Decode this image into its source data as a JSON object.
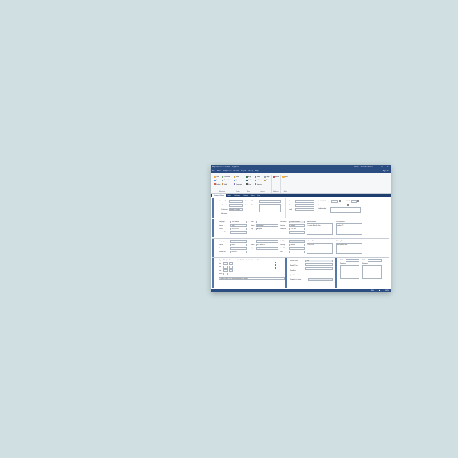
{
  "window": {
    "title": "Ship Shipments 2 (2/02) - ShipTrack",
    "user": "Admin",
    "status": "No Label Printer",
    "controls": {
      "minimize": "—",
      "maximize": "☐",
      "close": "✕"
    }
  },
  "menu": {
    "items": [
      "File",
      "Home",
      "Shipments",
      "Search",
      "Reports",
      "Setup",
      "Help"
    ],
    "right": "Sign Out"
  },
  "ribbon": {
    "groups": [
      {
        "label": "Shipment",
        "buttons": [
          "New",
          "Save",
          "Delete",
          "Duplicate",
          "Cancel",
          "Void"
        ]
      },
      {
        "label": "Rates",
        "buttons": [
          "Rate",
          "Quote",
          "Compare"
        ]
      },
      {
        "label": "Ship",
        "buttons": [
          "Ship",
          "Hold",
          "Print"
        ]
      },
      {
        "label": "Products",
        "buttons": [
          "Add",
          "Edit",
          "Remove",
          "Copy",
          "Paste"
        ]
      },
      {
        "label": "Address",
        "buttons": [
          "Book"
        ]
      },
      {
        "label": "Help",
        "buttons": [
          "Help"
        ]
      }
    ]
  },
  "tabs": [
    "Shipment Details",
    "Rates",
    "Packages",
    "History",
    "Notes",
    "Log"
  ],
  "sections": {
    "s1": {
      "left": {
        "shipment_label": "Shipment ID",
        "shipment_value": "SHP-000548",
        "account_label": "Account",
        "account_value": "Account 01",
        "customer_label": "Customer",
        "customer_value": "Sample Customer",
        "reference_label": "Reference",
        "reference_value": "",
        "phone_label": "Customer Phone",
        "phone_value": "555-555-5555",
        "notes_label": "Customer Notes"
      },
      "right": {
        "name_label": "Name",
        "phone_label": "Phone",
        "email_label": "Email",
        "cod_label": "Cash On Delivery",
        "cod_value": "0.00",
        "cod_fee_label": "COD Fee",
        "cod_fee_value": "0.00",
        "insurance_label": "Insurance",
        "undeliverable_label": "Undeliverable"
      }
    },
    "s2": {
      "company_label": "Company",
      "company_value": "Test Company",
      "contact_label": "Contact",
      "contact_value": "John",
      "phone_label": "Phone",
      "phone_value": "555-555-5555",
      "location_label": "Location ID",
      "location_value": "P123456",
      "suite_label": "Suite",
      "suite_value": "",
      "street_label": "Street",
      "street_value": "1000 Main St",
      "city_label": "City",
      "city_value": "Anytown",
      "province_label": "Prov/State",
      "province_value": "British Columbia",
      "country_label": "Country",
      "country_value": "Canada",
      "postal_label": "Postal/Zip",
      "postal_value": "V7X 1M3",
      "zone_label": "Zone",
      "zone_value": "",
      "addr_notes_label": "Address Notes",
      "addr_notes_value": "Location Notes & Gate",
      "pickup_notes_label": "Pick Up Notes",
      "pickup_notes_value": "use front TX"
    },
    "s3": {
      "company_label": "Company",
      "company_value": "Sample Business",
      "contact_label": "Contact",
      "contact_value": "Dave",
      "phone_label": "Phone",
      "phone_value": "555-555-5557",
      "location_label": "Location ID",
      "location_value": "P100000",
      "suite_label": "Suite",
      "suite_value": "12",
      "street_label": "Street",
      "street_value": "987 Market St",
      "city_label": "City",
      "city_value": "Anytown",
      "province_label": "Prov/State",
      "province_value": "British Columbia",
      "country_label": "Country",
      "country_value": "Canada",
      "postal_label": "Postal/Zip",
      "postal_value": "V6Y 1B7",
      "zone_label": "Zone",
      "zone_value": "",
      "addr_notes_label": "Address Notes",
      "addr_notes_value": "High Dock",
      "delivery_notes_label": "Delivery Notes",
      "delivery_notes_value": "Will call back to fill"
    },
    "s4": {
      "headers": [
        "Qty",
        "Weight",
        "Pieces",
        "Length",
        "Width",
        "Height",
        "Cubes",
        "DV"
      ],
      "rows": [
        "Box",
        "Skid",
        "Bag"
      ],
      "totals_label": "Totals",
      "note": "Products Notes (click select the on Items/Quantity)",
      "service_label": "Service level",
      "service_value": "Rush",
      "ready_label": "Ready Time",
      "deadline_label": "Deadline",
      "quote_label": "Quick Estimate",
      "dispatch_label": "Dispatch To Driver",
      "pod_label": "POD",
      "pod2_label": "POD",
      "sig_label": "Signature",
      "sig2_label": "Signature"
    }
  },
  "statusbar": {
    "zoom": "100%",
    "right": "100%"
  }
}
